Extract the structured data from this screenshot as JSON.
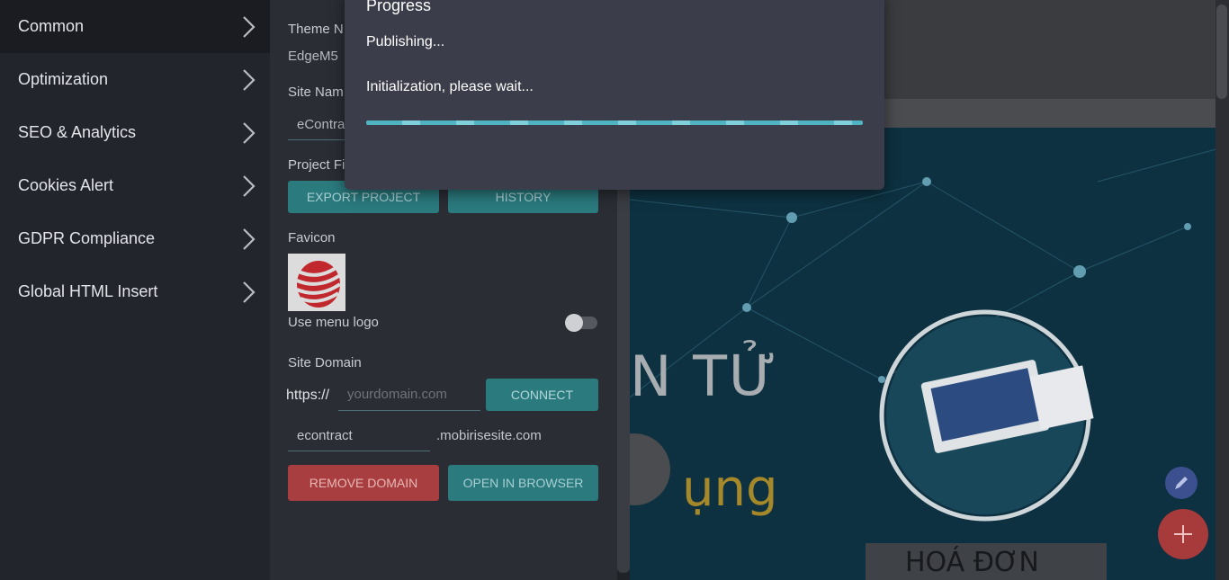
{
  "sidebar": {
    "items": [
      {
        "label": "Common"
      },
      {
        "label": "Optimization"
      },
      {
        "label": "SEO & Analytics"
      },
      {
        "label": "Cookies Alert"
      },
      {
        "label": "GDPR Compliance"
      },
      {
        "label": "Global HTML Insert"
      }
    ]
  },
  "panel": {
    "theme_label": "Theme N",
    "theme_value": "EdgeM5",
    "site_name_label": "Site Nam",
    "site_name_value": "eContra",
    "project_files_label": "Project Fi",
    "export_button": "EXPORT PROJECT",
    "history_button": "HISTORY",
    "favicon_label": "Favicon",
    "use_menu_logo_label": "Use menu logo",
    "site_domain_label": "Site Domain",
    "https_prefix": "https://",
    "domain_placeholder": "yourdomain.com",
    "connect_button": "CONNECT",
    "subdomain_value": "econtract",
    "subdomain_suffix": ".mobirisesite.com",
    "remove_domain_button": "REMOVE DOMAIN",
    "open_browser_button": "OPEN IN BROWSER"
  },
  "preview": {
    "hero_text_1": "N TỬ",
    "hero_text_2": "ụng",
    "hero_box_text": "HOÁ ĐƠN"
  },
  "modal": {
    "title": "Progress",
    "status": "Publishing...",
    "message": "Initialization, please wait...",
    "progress_percent": 100
  },
  "colors": {
    "accent_teal": "#2a7a7e",
    "danger_red": "#a83e3f",
    "progress": "#4fb3c2"
  }
}
